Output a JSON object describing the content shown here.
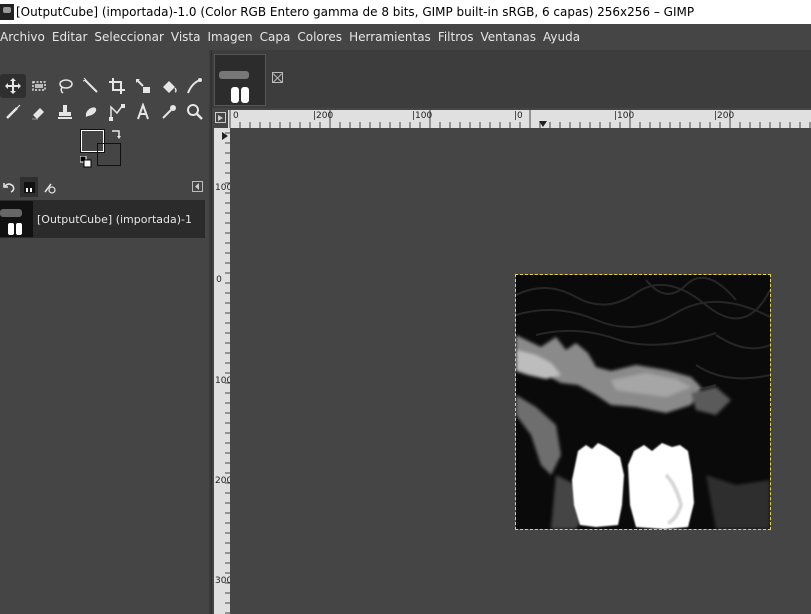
{
  "window": {
    "title": "[OutputCube] (importada)-1.0 (Color RGB Entero gamma de 8 bits, GIMP built-in sRGB, 6 capas) 256x256 – GIMP"
  },
  "menu": {
    "items": [
      "Archivo",
      "Editar",
      "Seleccionar",
      "Vista",
      "Imagen",
      "Capa",
      "Colores",
      "Herramientas",
      "Filtros",
      "Ventanas",
      "Ayuda"
    ]
  },
  "colors": {
    "foreground": "#8080ff",
    "background": "#22dd55"
  },
  "image_list": {
    "item_label": "[OutputCube] (importada)-1"
  },
  "rulers": {
    "horizontal": [
      "0",
      "|200",
      "|100",
      "|0",
      "|100",
      "|200"
    ],
    "vertical": [
      "100",
      "0",
      "100",
      "200",
      "300"
    ]
  }
}
